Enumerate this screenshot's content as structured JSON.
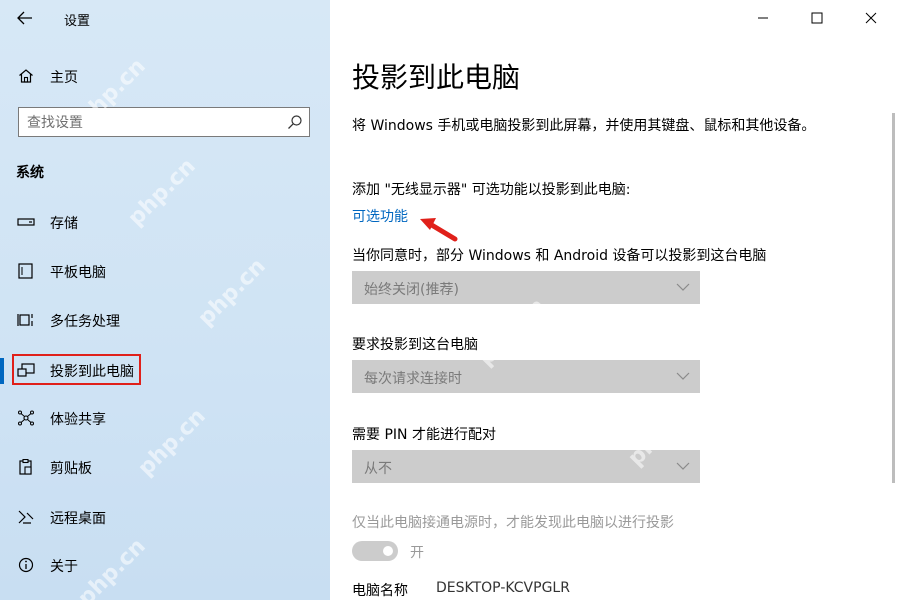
{
  "window": {
    "title": "设置"
  },
  "sidebar": {
    "home_label": "主页",
    "search_placeholder": "查找设置",
    "section_title": "系统",
    "items": [
      {
        "label": "存储",
        "icon": "storage-icon"
      },
      {
        "label": "平板电脑",
        "icon": "tablet-icon"
      },
      {
        "label": "多任务处理",
        "icon": "multitasking-icon"
      },
      {
        "label": "投影到此电脑",
        "icon": "projection-icon",
        "active": true
      },
      {
        "label": "体验共享",
        "icon": "shared-experiences-icon"
      },
      {
        "label": "剪贴板",
        "icon": "clipboard-icon"
      },
      {
        "label": "远程桌面",
        "icon": "remote-desktop-icon"
      },
      {
        "label": "关于",
        "icon": "info-icon"
      }
    ]
  },
  "main": {
    "title": "投影到此电脑",
    "description": "将 Windows 手机或电脑投影到此屏幕，并使用其键盘、鼠标和其他设备。",
    "add_text": "添加 \"无线显示器\" 可选功能以投影到此电脑:",
    "optional_link": "可选功能",
    "setting1_label": "当你同意时，部分 Windows 和 Android 设备可以投影到这台电脑",
    "setting1_value": "始终关闭(推荐)",
    "setting2_label": "要求投影到这台电脑",
    "setting2_value": "每次请求连接时",
    "setting3_label": "需要 PIN 才能进行配对",
    "setting3_value": "从不",
    "power_label": "仅当此电脑接通电源时，才能发现此电脑以进行投影",
    "toggle_label": "开",
    "toggle_on": true,
    "pc_name_label": "电脑名称",
    "pc_name_value": "DESKTOP-KCVPGLR"
  },
  "watermark": "php.cn",
  "colors": {
    "accent": "#0067c0",
    "highlight": "#e0201a",
    "disabled": "#cccccc"
  }
}
